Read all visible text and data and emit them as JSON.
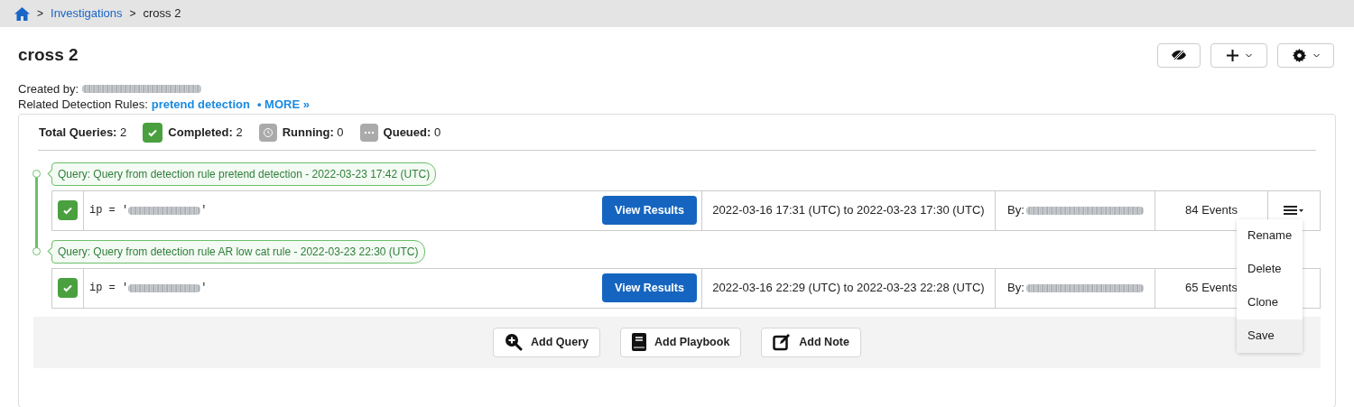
{
  "breadcrumbs": [
    {
      "label": "Investigations",
      "kind": "link",
      "separator": ">"
    },
    {
      "label": "cross 2",
      "kind": "current",
      "separator": ">"
    }
  ],
  "title": "cross 2",
  "created_by_label": "Created by:",
  "related_label": "Related Detection Rules:",
  "related_rule": "pretend detection",
  "more_link": "• MORE »",
  "stats": [
    {
      "kind": "total",
      "label": "Total Queries:",
      "value": "2"
    },
    {
      "kind": "completed",
      "label": "Completed:",
      "value": "2"
    },
    {
      "kind": "running",
      "label": "Running:",
      "value": "0"
    },
    {
      "kind": "queued",
      "label": "Queued:",
      "value": "0"
    }
  ],
  "queries": [
    {
      "label": "Query: Query from detection rule pretend detection - 2022-03-23 17:42 (UTC)",
      "completed": true,
      "query_prefix": "ip = '",
      "query_suffix": "'",
      "button": "View Results",
      "time_range": "2022-03-16 17:31 (UTC) to 2022-03-23 17:30 (UTC)",
      "by_label": "By:",
      "events": "84 Events",
      "menu": [
        {
          "label": "Rename",
          "selected": false
        },
        {
          "label": "Delete",
          "selected": false
        },
        {
          "label": "Clone",
          "selected": false
        },
        {
          "label": "Save",
          "selected": true
        }
      ]
    },
    {
      "label": "Query: Query from detection rule AR low cat rule - 2022-03-23 22:30 (UTC)",
      "completed": true,
      "query_prefix": "ip = '",
      "query_suffix": "'",
      "button": "View Results",
      "time_range": "2022-03-16 22:29 (UTC) to 2022-03-23 22:28 (UTC)",
      "by_label": "By:",
      "events": "65 Events"
    }
  ],
  "actions": [
    {
      "kind": "query",
      "label": "Add Query"
    },
    {
      "kind": "playbook",
      "label": "Add Playbook"
    },
    {
      "kind": "note",
      "label": "Add Note"
    }
  ]
}
